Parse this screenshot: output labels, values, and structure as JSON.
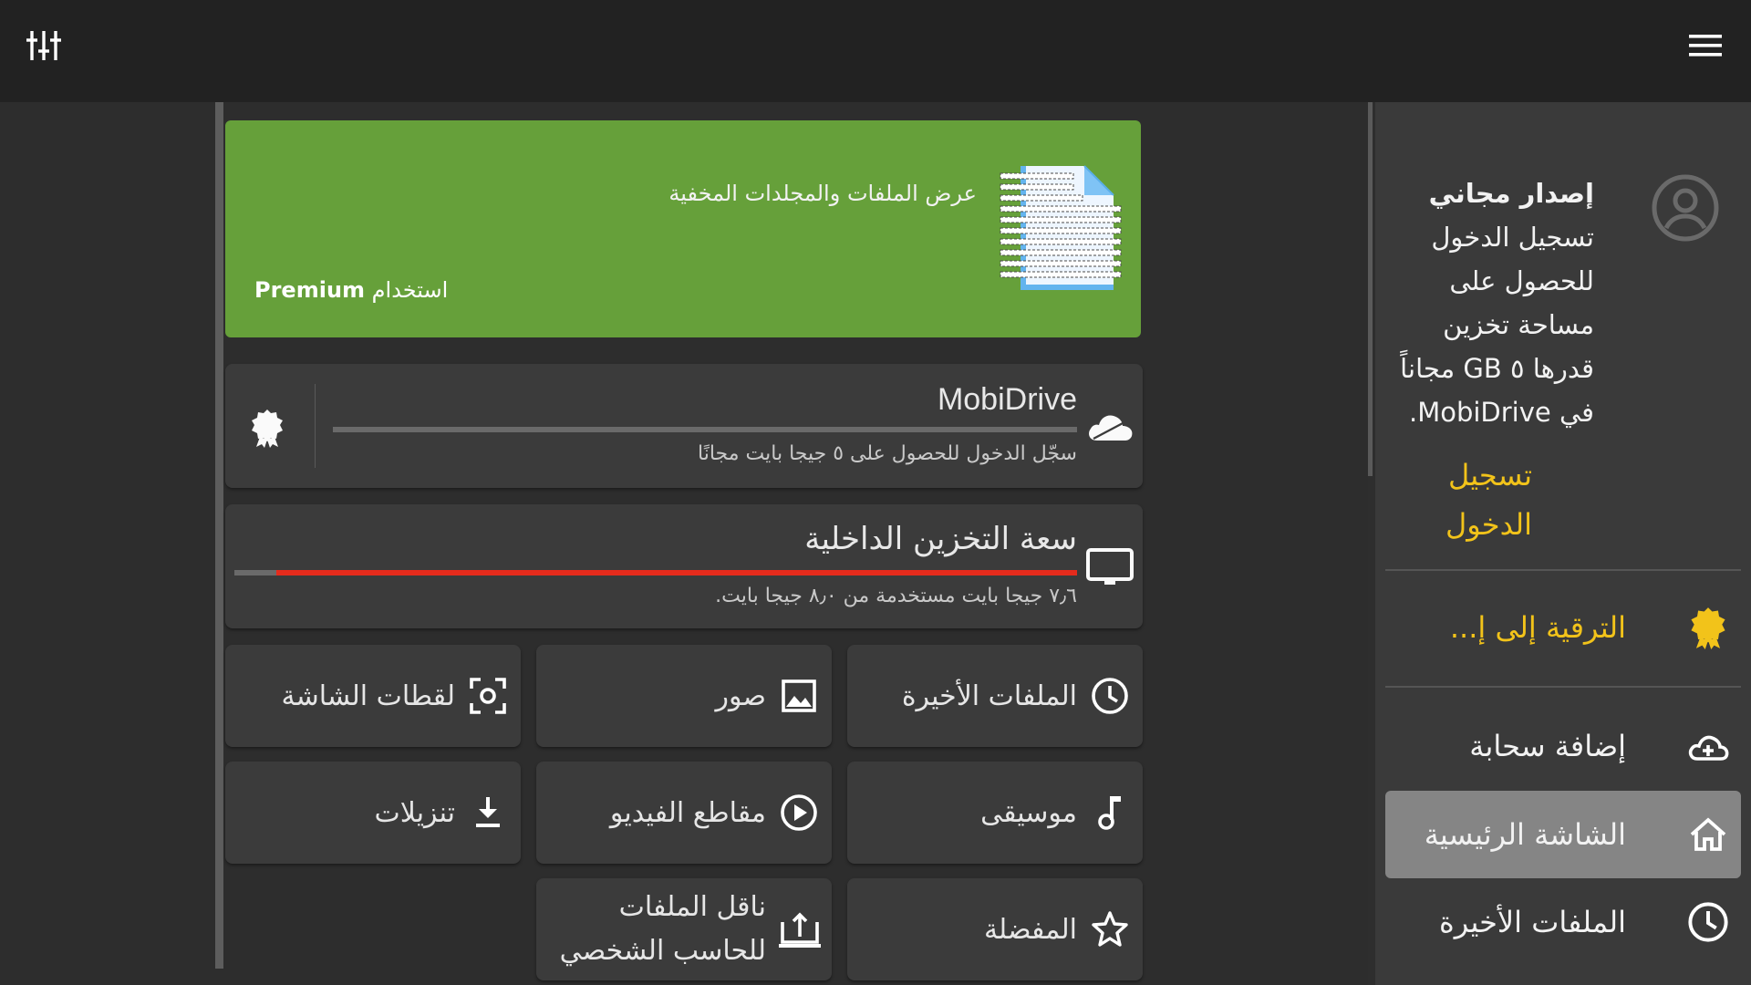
{
  "colors": {
    "topbar": "#222222",
    "background": "#2d2d2d",
    "sidebar": "#3a3a3a",
    "card": "#3b3b3b",
    "promo": "#66a03a",
    "accent_yellow": "#f2c31a",
    "storage_bar": "#e52b1c",
    "selected_item": "#858585"
  },
  "topbar": {
    "left_icon": "equalizer-sliders-icon",
    "right_icon": "hamburger-menu-icon"
  },
  "promo": {
    "title": "عرض الملفات والمجلدات المخفية",
    "cta_prefix": "استخدام",
    "cta_bold": "Premium",
    "icon": "document-icon"
  },
  "mobidrive": {
    "title": "MobiDrive",
    "subtitle": "سجّل الدخول للحصول على ٥ جيجا بايت مجانًا",
    "icon": "cloud-icon",
    "badge_icon": "premium-badge-icon"
  },
  "internal": {
    "title": "سعة التخزين الداخلية",
    "subtitle": "٧٫٦ جيجا بايت مستخدمة من ٨٫٠ جيجا بايت.",
    "used_fraction": 0.95,
    "icon": "monitor-icon"
  },
  "tiles": [
    {
      "label": "الملفات الأخيرة",
      "icon": "clock-icon"
    },
    {
      "label": "صور",
      "icon": "image-icon"
    },
    {
      "label": "لقطات الشاشة",
      "icon": "screenshot-icon"
    },
    {
      "label": "موسيقى",
      "icon": "music-note-icon"
    },
    {
      "label": "مقاطع الفيديو",
      "icon": "play-circle-icon"
    },
    {
      "label": "تنزيلات",
      "icon": "download-icon"
    },
    {
      "label": "المفضلة",
      "icon": "star-icon"
    },
    {
      "label": "ناقل الملفات للحاسب الشخصي",
      "icon": "pc-transfer-icon"
    }
  ],
  "sidebar": {
    "account_lines": [
      "إصدار مجاني",
      "تسجيل الدخول",
      "للحصول على",
      "مساحة تخزين",
      "قدرها ٥ GB مجاناً",
      "في MobiDrive."
    ],
    "login_lines": [
      "تسجيل",
      "الدخول"
    ],
    "upgrade": "الترقية إلى إ...",
    "items": [
      {
        "label": "إضافة سحابة",
        "icon": "cloud-add-icon"
      },
      {
        "label": "الشاشة الرئيسية",
        "icon": "home-icon",
        "selected": true
      },
      {
        "label": "الملفات الأخيرة",
        "icon": "clock-icon"
      }
    ]
  }
}
